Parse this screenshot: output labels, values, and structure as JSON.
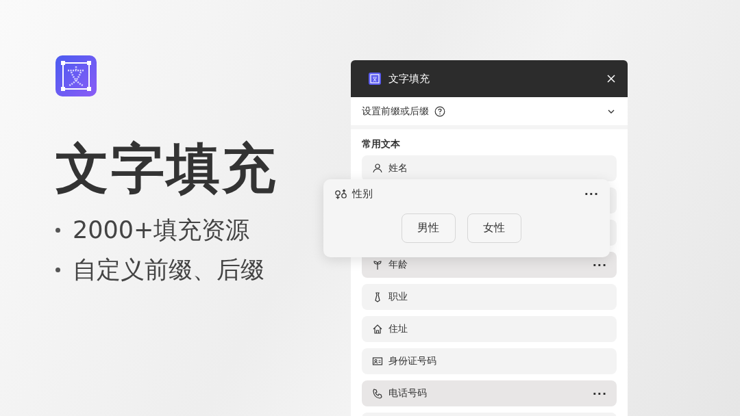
{
  "promo": {
    "title": "文字填充",
    "bullets": [
      "2000+填充资源",
      "自定义前缀、后缀"
    ]
  },
  "panel": {
    "title": "文字填充",
    "setting": {
      "label": "设置前缀或后缀",
      "expanded": false
    },
    "section_title": "常用文本",
    "items": [
      {
        "kind": "row",
        "label": "姓名",
        "hovered": false
      },
      {
        "kind": "blank"
      },
      {
        "kind": "blank"
      },
      {
        "kind": "row",
        "label": "年龄",
        "hovered": true,
        "more": "···"
      },
      {
        "kind": "row",
        "label": "职业",
        "hovered": false
      },
      {
        "kind": "row",
        "label": "住址",
        "hovered": false
      },
      {
        "kind": "row",
        "label": "身份证号码",
        "hovered": false
      },
      {
        "kind": "row",
        "label": "电话号码",
        "hovered": true,
        "more": "···"
      },
      {
        "kind": "blank"
      }
    ]
  },
  "popup": {
    "title": "性别",
    "more": "···",
    "options": [
      "男性",
      "女性"
    ]
  }
}
